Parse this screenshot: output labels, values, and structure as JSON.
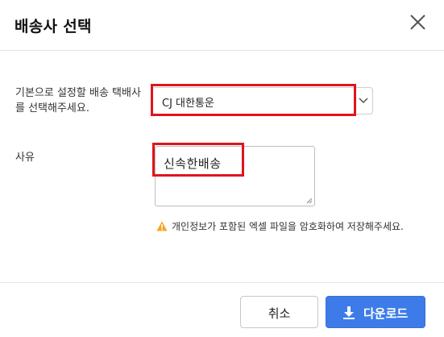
{
  "dialog": {
    "title": "배송사 선택"
  },
  "form": {
    "carrier_label": "기본으로 설정할 배송 택배사를 선택해주세요.",
    "carrier_value": "CJ 대한통운",
    "reason_label": "사유",
    "reason_value": "신속한배송",
    "warning_text": "개인정보가 포함된 엑셀 파일을 암호화하여 저장해주세요."
  },
  "footer": {
    "cancel_label": "취소",
    "download_label": "다운로드"
  },
  "colors": {
    "highlight": "#e0141c",
    "primary": "#3d7ce8",
    "warning": "#f5a623"
  },
  "icons": {
    "close": "close-icon",
    "chevron": "chevron-down-icon",
    "warning": "warning-icon",
    "download": "download-icon"
  }
}
